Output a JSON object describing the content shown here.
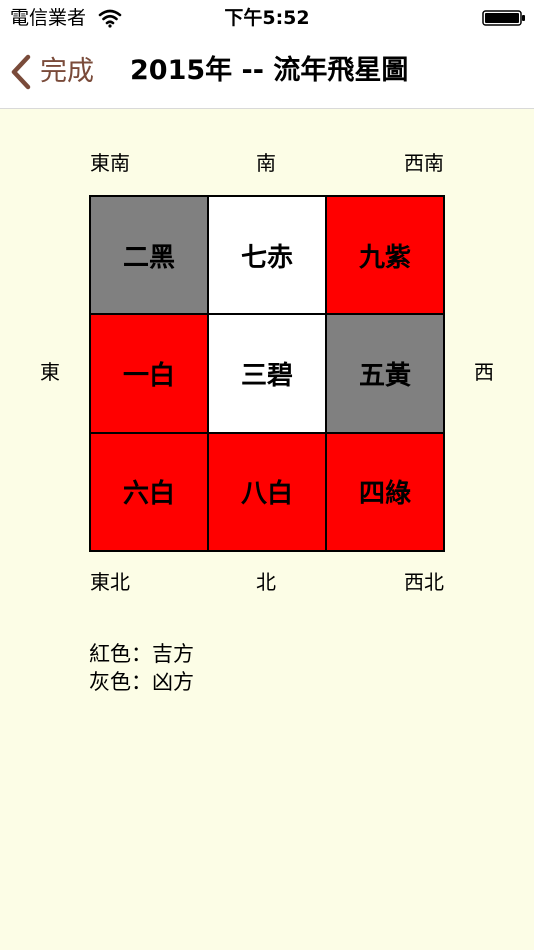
{
  "status_bar": {
    "carrier": "電信業者",
    "time": "下午5:52"
  },
  "nav": {
    "back_label": "完成",
    "title": "2015年 -- 流年飛星圖"
  },
  "directions": {
    "southeast": "東南",
    "south": "南",
    "southwest": "西南",
    "east": "東",
    "west": "西",
    "northeast": "東北",
    "north": "北",
    "northwest": "西北"
  },
  "colors": {
    "good": "#ff0000",
    "bad": "#808080",
    "neutral": "#ffffff",
    "back_accent": "#7a4b3a",
    "content_bg": "#fcfde6"
  },
  "grid": [
    {
      "label": "二黑",
      "type": "bad"
    },
    {
      "label": "七赤",
      "type": "neutral"
    },
    {
      "label": "九紫",
      "type": "good"
    },
    {
      "label": "一白",
      "type": "good"
    },
    {
      "label": "三碧",
      "type": "neutral"
    },
    {
      "label": "五黃",
      "type": "bad"
    },
    {
      "label": "六白",
      "type": "good"
    },
    {
      "label": "八白",
      "type": "good"
    },
    {
      "label": "四綠",
      "type": "good"
    }
  ],
  "legend": {
    "red": "紅色：吉方",
    "gray": "灰色：凶方"
  }
}
